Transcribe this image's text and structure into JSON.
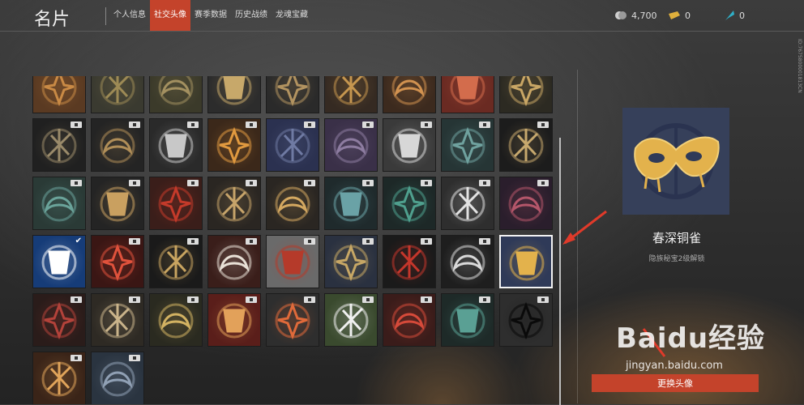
{
  "app": {
    "title": "名片"
  },
  "tabs": [
    {
      "label": "个人信息",
      "active": false
    },
    {
      "label": "社交头像",
      "active": true
    },
    {
      "label": "赛季数据",
      "active": false
    },
    {
      "label": "历史战绩",
      "active": false
    },
    {
      "label": "龙魂宝藏",
      "active": false
    }
  ],
  "currencies": [
    {
      "icon": "coin-icon",
      "value": "4,700"
    },
    {
      "icon": "ticket-icon",
      "value": "0"
    },
    {
      "icon": "feather-icon",
      "value": "0"
    }
  ],
  "side_id": "ID:7675800001813CN",
  "avatars": [
    {
      "icon": "sword-emblem-avatar",
      "bg": "#5a3a22",
      "fg": "#c98a45"
    },
    {
      "icon": "bow-avatar",
      "bg": "#3a3a30",
      "fg": "#9d8a55"
    },
    {
      "icon": "crossed-weapons-avatar",
      "bg": "#3b3a2a",
      "fg": "#a39060"
    },
    {
      "icon": "cannon-avatar",
      "bg": "#2c2c2c",
      "fg": "#c7a86a"
    },
    {
      "icon": "gun-avatar",
      "bg": "#2a2a2a",
      "fg": "#b29360"
    },
    {
      "icon": "spear-avatar",
      "bg": "#352a22",
      "fg": "#c5964f"
    },
    {
      "icon": "blade-avatar",
      "bg": "#3c2a1e",
      "fg": "#d19250"
    },
    {
      "icon": "red-mace-avatar",
      "bg": "#6a2a22",
      "fg": "#d36c4c"
    },
    {
      "icon": "trident-avatar",
      "bg": "#2c2a22",
      "fg": "#c9a665"
    },
    {
      "icon": "dagger-avatar",
      "bg": "#202020",
      "fg": "#9a8a6a",
      "locked": true
    },
    {
      "icon": "fan-blade-avatar",
      "bg": "#242424",
      "fg": "#b08e58",
      "locked": true
    },
    {
      "icon": "silver-dragon-avatar",
      "bg": "#2a2a2a",
      "fg": "#c8c8c8",
      "locked": true
    },
    {
      "icon": "gold-dragon-avatar",
      "bg": "#3b281a",
      "fg": "#e0993f",
      "locked": true
    },
    {
      "icon": "warrior-face-avatar",
      "bg": "#2b3150",
      "fg": "#6f7aa3",
      "locked": true
    },
    {
      "icon": "maiden-face-avatar",
      "bg": "#3a3048",
      "fg": "#8d7ca0",
      "locked": true
    },
    {
      "icon": "white-serpent-avatar",
      "bg": "#3a3a3a",
      "fg": "#d7d7d7",
      "locked": true
    },
    {
      "icon": "jade-dragon-avatar",
      "bg": "#263535",
      "fg": "#6fa19e",
      "locked": true
    },
    {
      "icon": "vajra-avatar",
      "bg": "#1c1c1c",
      "fg": "#c6a86d",
      "locked": true
    },
    {
      "icon": "green-seal-avatar",
      "bg": "#2a3a36",
      "fg": "#6aa39a",
      "locked": true
    },
    {
      "icon": "gold-lotus-avatar",
      "bg": "#242424",
      "fg": "#c9a060",
      "locked": true
    },
    {
      "icon": "red-glyph-avatar",
      "bg": "#3a1e1a",
      "fg": "#c43a2a",
      "locked": true
    },
    {
      "icon": "tiger-mask-avatar",
      "bg": "#2a2622",
      "fg": "#c7a46a",
      "locked": true
    },
    {
      "icon": "gold-phoenix-avatar",
      "bg": "#2a2622",
      "fg": "#d4a860",
      "locked": true
    },
    {
      "icon": "teal-lotus-avatar",
      "bg": "#1f2a2c",
      "fg": "#6aa2a6",
      "locked": true
    },
    {
      "icon": "teal-flame-avatar",
      "bg": "#1d2827",
      "fg": "#4fa08e",
      "locked": true
    },
    {
      "icon": "hex-logo-avatar",
      "bg": "#2e2e2e",
      "fg": "#e2e2e2",
      "locked": true
    },
    {
      "icon": "crimson-demon-avatar",
      "bg": "#2a1e2c",
      "fg": "#b4566a",
      "locked": true
    },
    {
      "icon": "blue-cloud-avatar",
      "bg": "#163c78",
      "fg": "#ffffff",
      "checked": true
    },
    {
      "icon": "red-lotus-avatar",
      "bg": "#3a1614",
      "fg": "#e0523c",
      "locked": true
    },
    {
      "icon": "gold-scythe-avatar",
      "bg": "#1a1a1a",
      "fg": "#c8a460",
      "locked": true
    },
    {
      "icon": "paper-crane-avatar",
      "bg": "#3a1e1a",
      "fg": "#e8e0d6",
      "locked": true
    },
    {
      "icon": "red-parasol-avatar",
      "bg": "#6a6a6a",
      "fg": "#b53a2a",
      "locked": true
    },
    {
      "icon": "treasure-sack-avatar",
      "bg": "#2a3140",
      "fg": "#c7a765",
      "locked": true
    },
    {
      "icon": "red-charm-avatar",
      "bg": "#1a1a1a",
      "fg": "#c4362b",
      "locked": true
    },
    {
      "icon": "half-mask-avatar",
      "bg": "#1e1e1e",
      "fg": "#d9d9d9",
      "locked": true
    },
    {
      "icon": "gold-mask-avatar",
      "bg": "#2f3a58",
      "fg": "#e3b24c",
      "selected": true
    },
    {
      "icon": "red-flute-avatar",
      "bg": "#2a1c1a",
      "fg": "#b3423a",
      "locked": true
    },
    {
      "icon": "horn-avatar",
      "bg": "#2e2a24",
      "fg": "#c9b38a",
      "locked": true
    },
    {
      "icon": "cloak-avatar",
      "bg": "#2a2a20",
      "fg": "#d2b262",
      "locked": true
    },
    {
      "icon": "fish-lantern-avatar",
      "bg": "#5a1e1a",
      "fg": "#e2a15a",
      "locked": true
    },
    {
      "icon": "orange-cat-avatar",
      "bg": "#2e2e2e",
      "fg": "#e06a3a",
      "locked": true
    },
    {
      "icon": "panda-avatar",
      "bg": "#3a4a2e",
      "fg": "#f0f0f0",
      "locked": true
    },
    {
      "icon": "red-cat-avatar",
      "bg": "#3a1c1a",
      "fg": "#d64a3a",
      "locked": true
    },
    {
      "icon": "teal-mask-avatar",
      "bg": "#1e2a28",
      "fg": "#5aa094",
      "locked": true
    },
    {
      "icon": "ink-claw-avatar",
      "bg": "#2e2e2e",
      "fg": "#0a0a0a",
      "locked": true
    },
    {
      "icon": "torii-gate-avatar",
      "bg": "#3a2418",
      "fg": "#e0a45a",
      "locked": true
    },
    {
      "icon": "ship-mast-avatar",
      "bg": "#2a3440",
      "fg": "#90a0b4",
      "locked": true
    }
  ],
  "preview": {
    "icon": "gold-mask-icon",
    "name": "春深铜雀",
    "desc": "隐族秘宝2级解锁"
  },
  "confirm_label": "更换头像",
  "watermark": {
    "logo": "Baidu经验",
    "url": "jingyan.baidu.com"
  },
  "colors": {
    "accent": "#c4432b",
    "preview_bg": "#36405a",
    "mask_gold": "#e3b24c",
    "arrow_red": "#e03a2a"
  }
}
